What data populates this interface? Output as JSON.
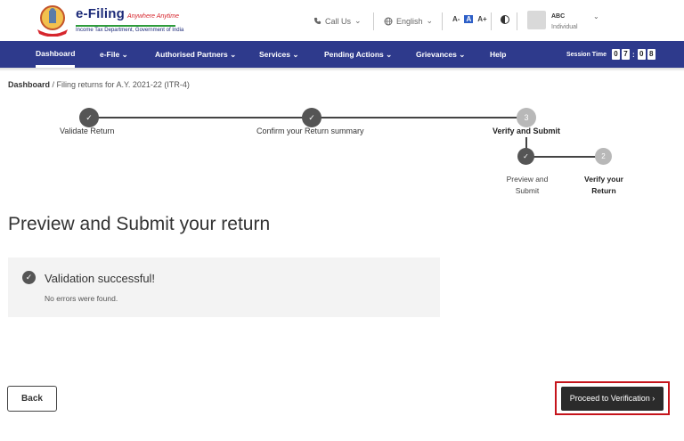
{
  "header": {
    "brand": "e-Filing",
    "tagline": "Anywhere Anytime",
    "subtitle": "Income Tax Department, Government of India",
    "call_us": "Call Us",
    "language": "English",
    "font_controls": [
      "A-",
      "A",
      "A+"
    ],
    "user_name": "ABC",
    "user_role": "Individual"
  },
  "nav": {
    "items": [
      "Dashboard",
      "e-File",
      "Authorised Partners",
      "Services",
      "Pending Actions",
      "Grievances",
      "Help"
    ],
    "session_label": "Session Time",
    "session_digits": [
      "0",
      "7",
      "0",
      "8"
    ]
  },
  "breadcrumb": {
    "home": "Dashboard",
    "current": " / Filing returns for A.Y. 2021-22 (ITR-4)"
  },
  "stepper": {
    "steps": [
      {
        "label": "Validate Return",
        "status": "done"
      },
      {
        "label": "Confirm your Return summary",
        "status": "done"
      },
      {
        "label": "Verify and Submit",
        "number": "3",
        "status": "current"
      }
    ],
    "substeps": [
      {
        "label_1": "Preview and",
        "label_2": "Submit",
        "status": "done"
      },
      {
        "label_1": "Verify your",
        "label_2": "Return",
        "number": "2",
        "status": "current"
      }
    ]
  },
  "main": {
    "title": "Preview and Submit your return",
    "validation_title": "Validation successful!",
    "validation_message": "No errors were found."
  },
  "actions": {
    "back": "Back",
    "proceed": "Proceed to Verification"
  },
  "colors": {
    "nav_bg": "#2e3a8c",
    "highlight": "#c5141b",
    "step_done": "#555555",
    "step_todo": "#b8b8b8"
  }
}
